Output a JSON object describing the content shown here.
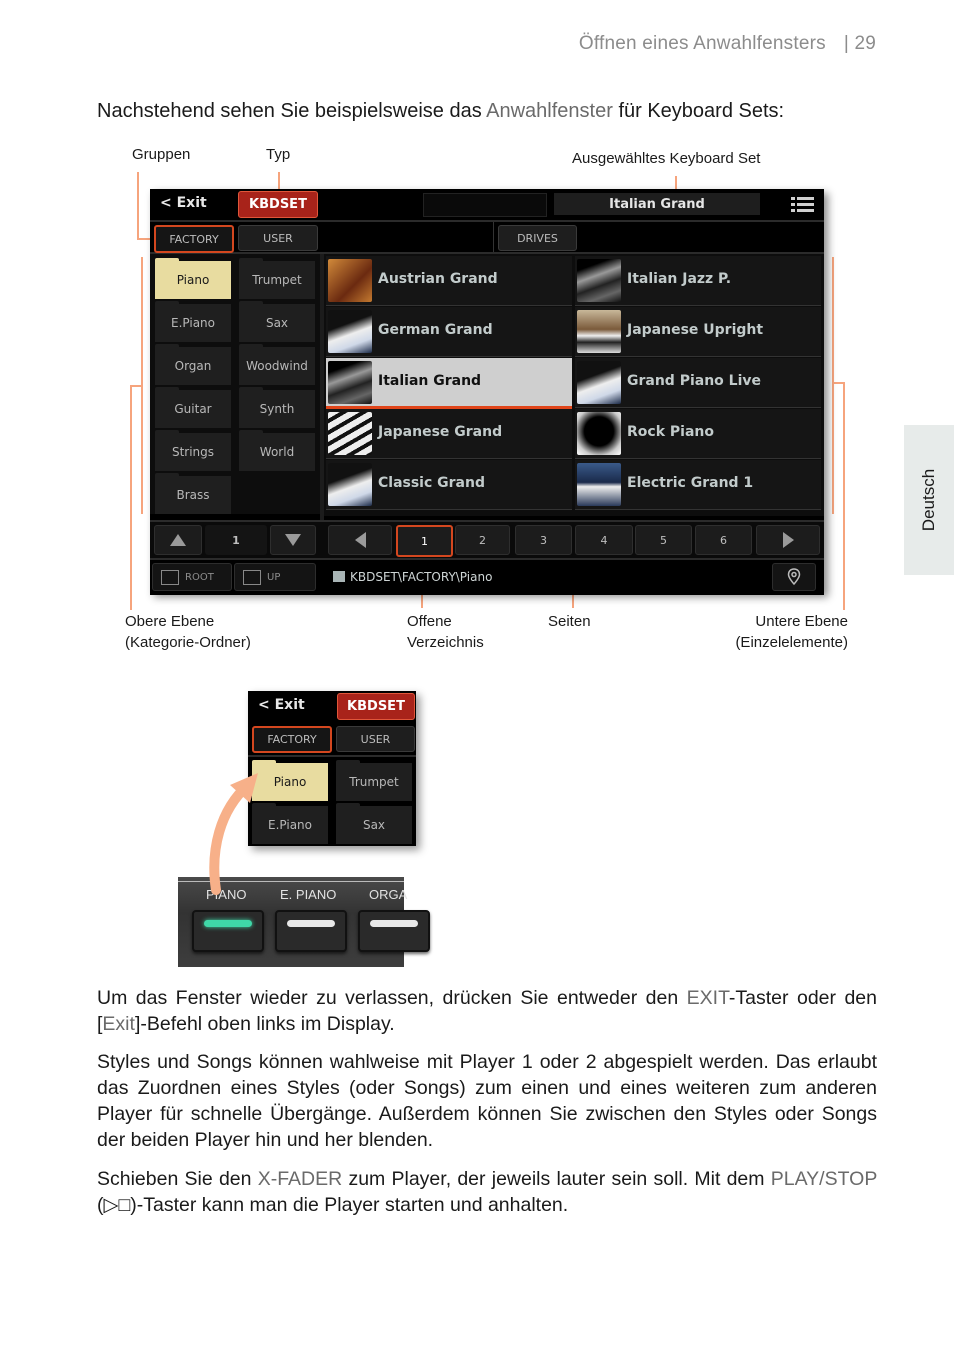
{
  "header": {
    "section_title": "Öffnen eines Anwahlfensters",
    "page_number": "| 29"
  },
  "side_tab": {
    "label": "Deutsch"
  },
  "intro": {
    "before": "Nachstehend sehen Sie beispielsweise das ",
    "highlight": "Anwahlfenster",
    "after": " für Keyboard Sets:"
  },
  "annotations": {
    "groups": "Gruppen",
    "type": "Typ",
    "selected_set": "Ausgewähltes Keyboard Set",
    "upper_level_1": "Obere Ebene",
    "upper_level_2": "(Kategorie-Ordner)",
    "open_dir_1": "Offene",
    "open_dir_2": "Verzeichnis",
    "pages": "Seiten",
    "lower_level_1": "Untere Ebene",
    "lower_level_2": "(Einzelelemente)"
  },
  "screen": {
    "exit_label": "< Exit",
    "type_label": "KBDSET",
    "selected_name": "Italian Grand",
    "menu_icon": "hamburger-list-icon",
    "tabs": [
      "FACTORY",
      "USER",
      "DRIVES"
    ],
    "selected_tab": "FACTORY",
    "categories": [
      "Piano",
      "Trumpet",
      "E.Piano",
      "Sax",
      "Organ",
      "Woodwind",
      "Guitar",
      "Synth",
      "Strings",
      "World",
      "Brass"
    ],
    "selected_category": "Piano",
    "items_left": [
      "Austrian Grand",
      "German Grand",
      "Italian Grand",
      "Japanese Grand",
      "Classic Grand"
    ],
    "items_right": [
      "Italian Jazz P.",
      "Japanese Upright",
      "Grand Piano Live",
      "Rock Piano",
      "Electric Grand 1"
    ],
    "selected_item": "Italian Grand",
    "cat_page": "1",
    "pages": [
      "1",
      "2",
      "3",
      "4",
      "5",
      "6"
    ],
    "current_page": "1",
    "root_label": "ROOT",
    "up_label": "UP",
    "path": "KBDSET\\FACTORY\\Piano",
    "colors": {
      "accent": "#d4471f",
      "type_bg": "#a8231a",
      "category_selected": "#e8dca0",
      "item_selected": "#cfcfcf"
    }
  },
  "mini_screen": {
    "exit_label": "< Exit",
    "type_label": "KBDSET",
    "tabs": [
      "FACTORY",
      "USER"
    ],
    "categories": [
      "Piano",
      "Trumpet",
      "E.Piano",
      "Sax"
    ]
  },
  "panel": {
    "buttons": [
      "PIANO",
      "E. PIANO",
      "ORGA"
    ],
    "led_colors": [
      "#3fd8a8",
      "#e8e8e8",
      "#e8e8e8"
    ]
  },
  "paragraphs": {
    "p1_a": "Um das Fenster wieder zu verlassen, drücken Sie entweder den ",
    "p1_b": "EXIT",
    "p1_c": "-Taster oder den [",
    "p1_d": "Exit",
    "p1_e": "]-Befehl oben links im Display.",
    "p2": "Styles und Songs können wahlweise mit Player 1 oder 2 abgespielt werden. Das erlaubt das Zuordnen eines Styles (oder Songs) zum einen und eines weiteren zum anderen Player für schnelle Übergänge. Außerdem können Sie zwischen den Styles oder Songs der beiden Player hin und her blenden.",
    "p3_a": "Schieben Sie den ",
    "p3_b": "X-FADER",
    "p3_c": " zum Player, der jeweils lauter sein soll. Mit dem ",
    "p3_d": "PLAY/STOP",
    "p3_e": " (",
    "p3_f": "▷□",
    "p3_g": ")-Taster kann man die Player starten und anhalten."
  }
}
